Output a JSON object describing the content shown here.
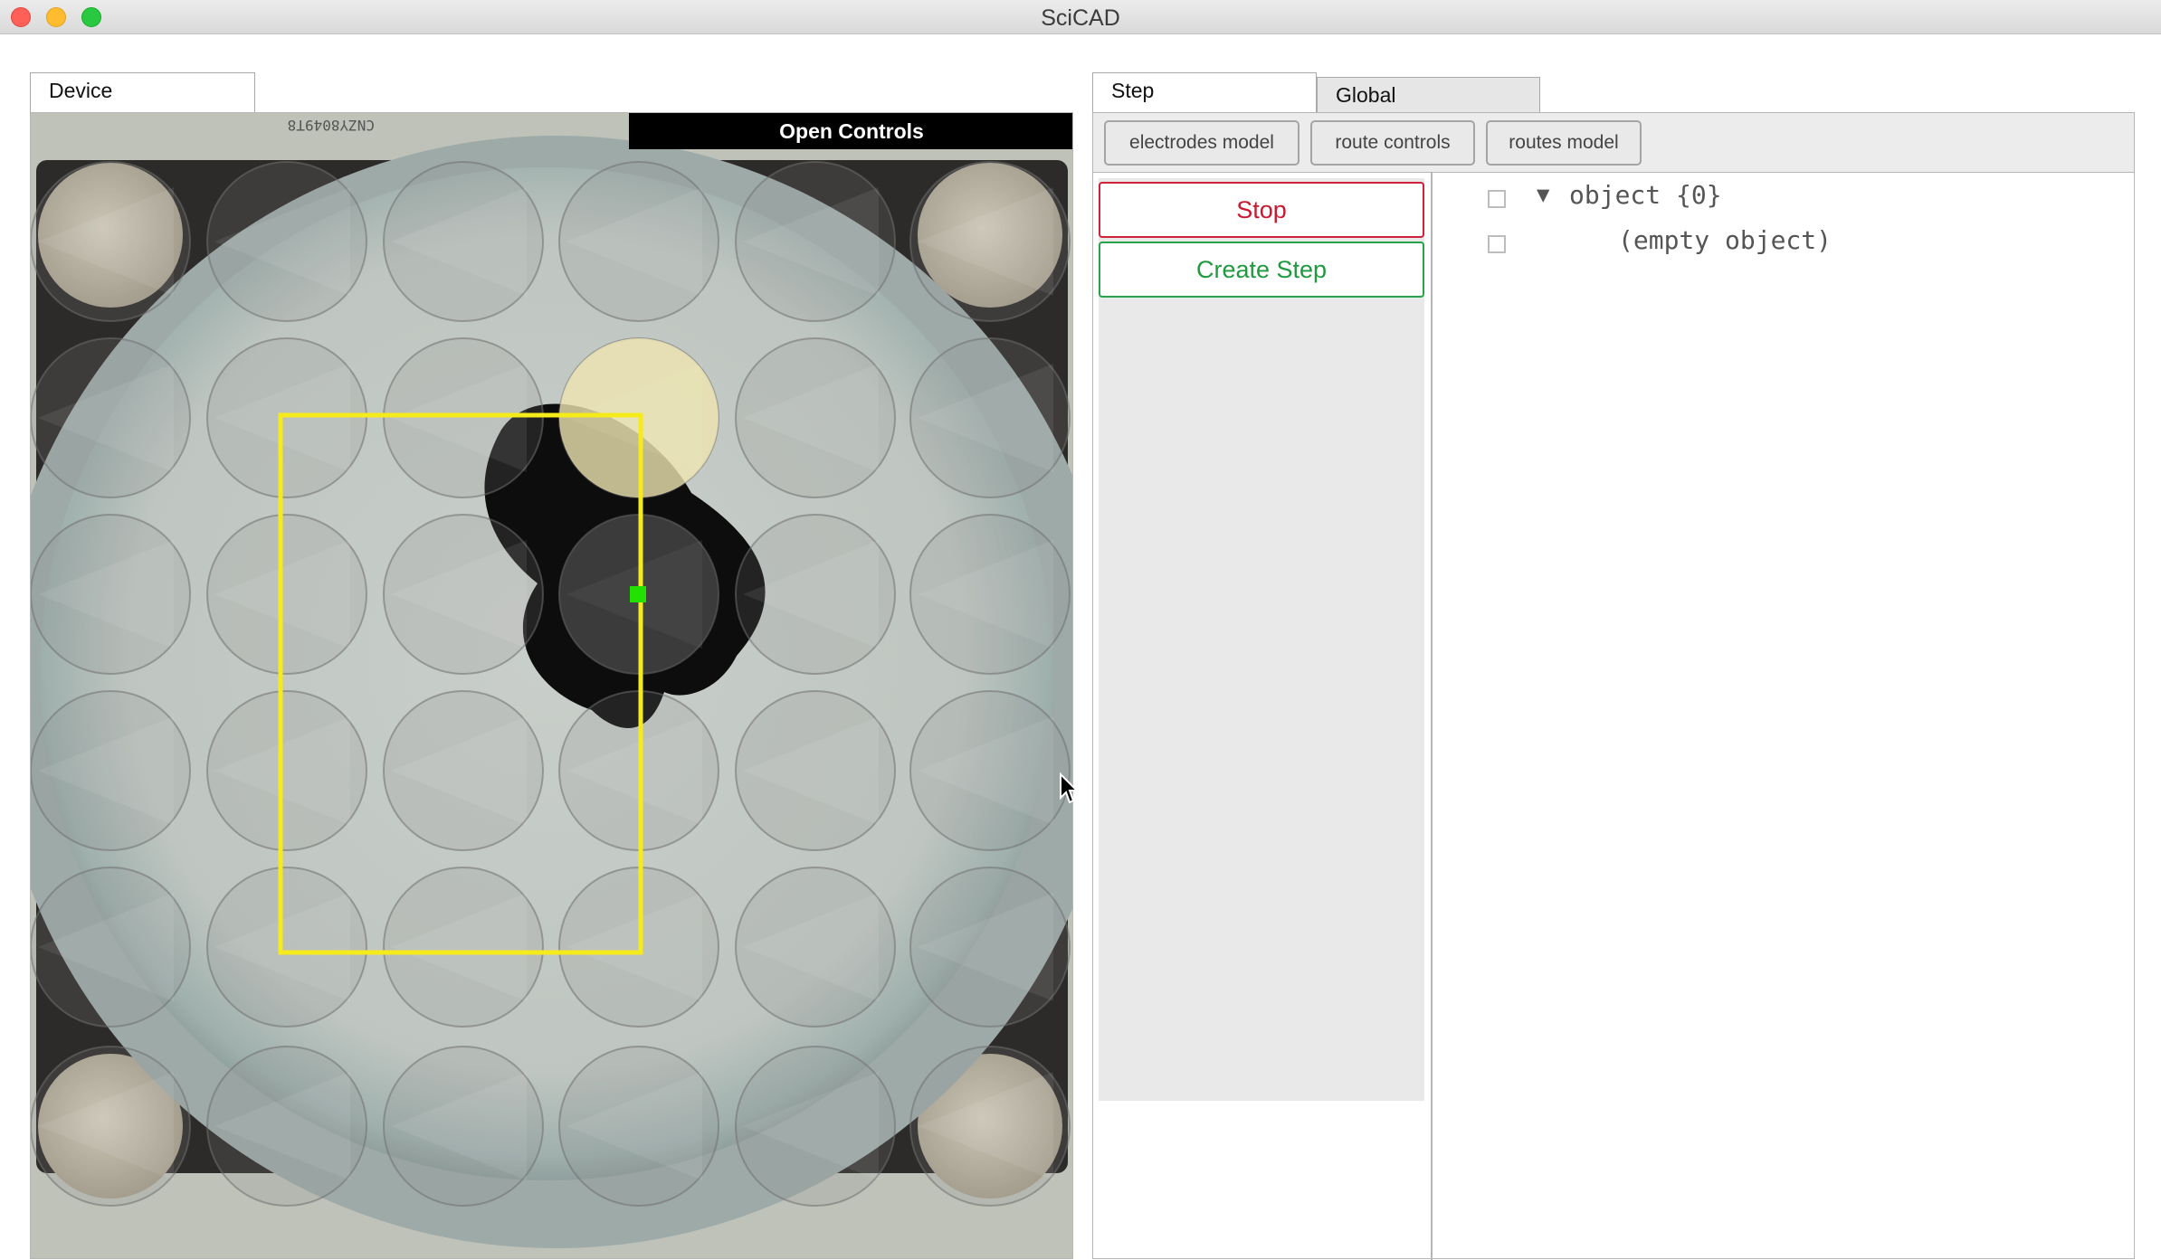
{
  "window": {
    "title": "SciCAD"
  },
  "left_panel": {
    "tab_label": "Device",
    "overlay_button": "Open Controls",
    "chip_label_text": "CNZY8049T8"
  },
  "right_panel": {
    "tabs": [
      {
        "label": "Step",
        "active": true
      },
      {
        "label": "Global",
        "active": false
      }
    ],
    "toolbar_buttons": [
      "electrodes model",
      "route controls",
      "routes model"
    ],
    "step_buttons": {
      "stop": "Stop",
      "create_step": "Create Step"
    },
    "tree": {
      "root_label": "object {0}",
      "expanded": true,
      "child_label": "(empty object)"
    }
  },
  "colors": {
    "selection_rect": "#f5ea1a",
    "handle": "#22e000",
    "stop": "#c9182f",
    "create": "#1f9a3e"
  }
}
